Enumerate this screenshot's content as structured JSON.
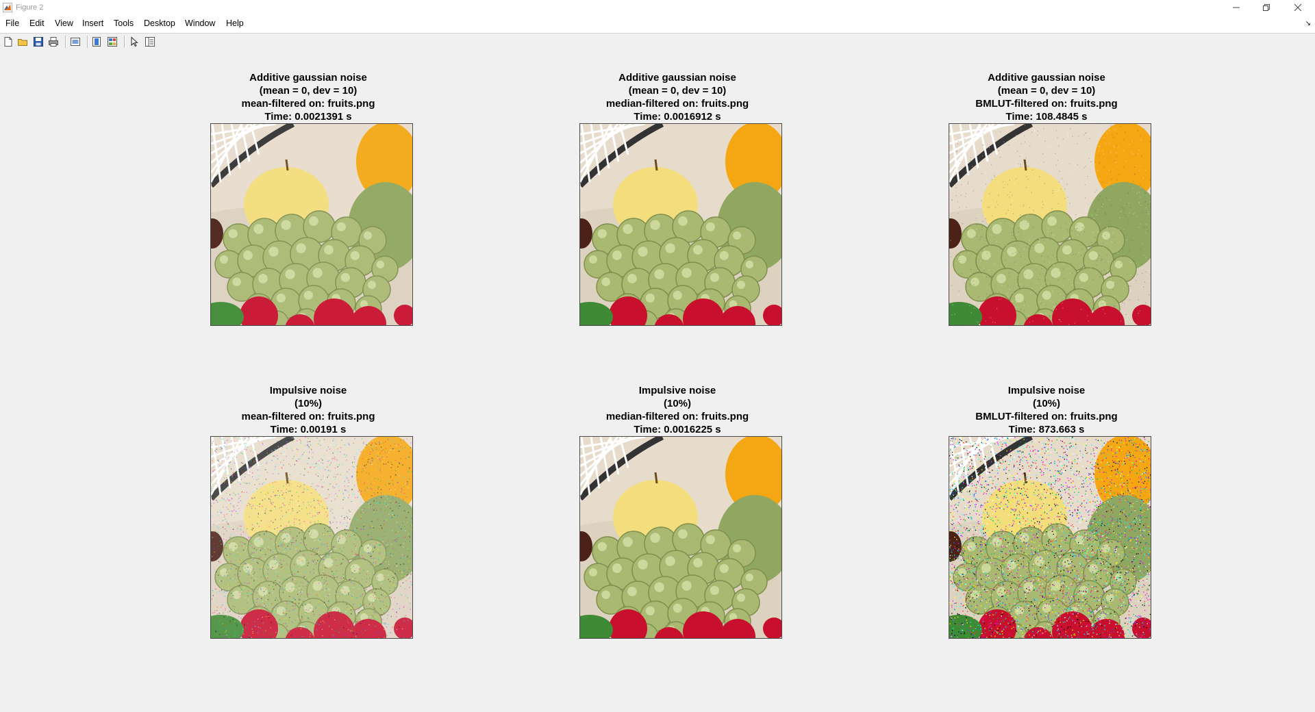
{
  "window": {
    "title": "Figure 2"
  },
  "menu": {
    "items": [
      "File",
      "Edit",
      "View",
      "Insert",
      "Tools",
      "Desktop",
      "Window",
      "Help"
    ]
  },
  "toolbar": {
    "buttons": [
      {
        "name": "new-figure-icon"
      },
      {
        "name": "open-file-icon"
      },
      {
        "name": "save-icon"
      },
      {
        "name": "print-icon"
      },
      {
        "name": "link-plot-icon"
      },
      {
        "name": "insert-colorbar-icon"
      },
      {
        "name": "insert-legend-icon"
      },
      {
        "name": "edit-plot-arrow-icon"
      },
      {
        "name": "property-inspector-icon"
      }
    ]
  },
  "panels": [
    {
      "title_lines": [
        "Additive gaussian noise",
        "(mean = 0, dev = 10)",
        "mean-filtered on: fruits.png",
        "Time: 0.0021391 s"
      ],
      "noise": "gaussian-mean"
    },
    {
      "title_lines": [
        "Additive gaussian noise",
        "(mean = 0, dev = 10)",
        "median-filtered on: fruits.png",
        "Time: 0.0016912 s"
      ],
      "noise": "gaussian-median"
    },
    {
      "title_lines": [
        "Additive gaussian noise",
        "(mean = 0, dev = 10)",
        "BMLUT-filtered on: fruits.png",
        "Time: 108.4845 s"
      ],
      "noise": "gaussian-bmlut"
    },
    {
      "title_lines": [
        "Impulsive noise",
        "(10%)",
        "mean-filtered on: fruits.png",
        "Time: 0.00191 s"
      ],
      "noise": "impulse-mean"
    },
    {
      "title_lines": [
        "Impulsive noise",
        "(10%)",
        "median-filtered on: fruits.png",
        "Time: 0.0016225 s"
      ],
      "noise": "impulse-median"
    },
    {
      "title_lines": [
        "Impulsive noise",
        "(10%)",
        "BMLUT-filtered on: fruits.png",
        "Time: 873.663 s"
      ],
      "noise": "impulse-bmlut"
    }
  ],
  "colors": {
    "background": "#f0f0f0",
    "grape": "#a9b972",
    "apple": "#f4dd7c",
    "orange": "#f4a713",
    "red": "#c8102e",
    "leaf": "#3f8a34",
    "racket": "#ffffff"
  }
}
